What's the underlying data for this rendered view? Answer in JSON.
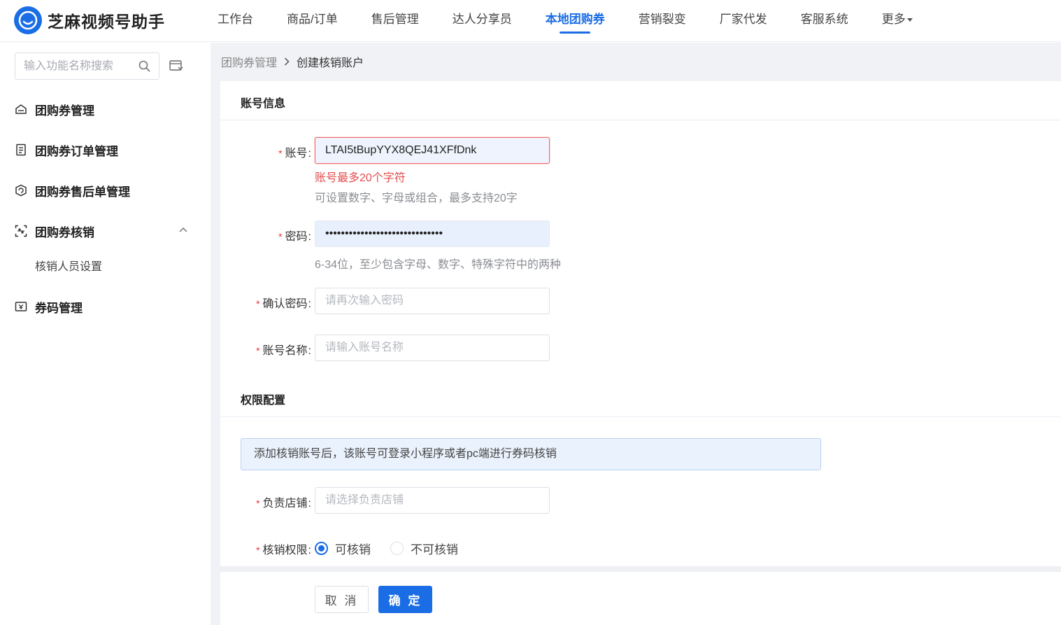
{
  "app": {
    "title": "芝麻视频号助手"
  },
  "nav": {
    "items": [
      {
        "label": "工作台"
      },
      {
        "label": "商品/订单"
      },
      {
        "label": "售后管理"
      },
      {
        "label": "达人分享员"
      },
      {
        "label": "本地团购券",
        "active": true
      },
      {
        "label": "营销裂变"
      },
      {
        "label": "厂家代发"
      },
      {
        "label": "客服系统"
      },
      {
        "label": "更多"
      }
    ]
  },
  "sidebar": {
    "search_placeholder": "输入功能名称搜索",
    "items": [
      {
        "label": "团购券管理",
        "icon": "coupon-icon"
      },
      {
        "label": "团购券订单管理",
        "icon": "order-list-icon"
      },
      {
        "label": "团购券售后单管理",
        "icon": "aftersale-icon"
      },
      {
        "label": "团购券核销",
        "icon": "scan-icon",
        "expanded": true,
        "children": [
          {
            "label": "核销人员设置"
          }
        ]
      },
      {
        "label": "券码管理",
        "icon": "ticket-icon"
      }
    ]
  },
  "breadcrumb": {
    "parent": "团购券管理",
    "current": "创建核销账户"
  },
  "form": {
    "account_section_title": "账号信息",
    "account": {
      "label": "账号",
      "value": "LTAI5tBupYYX8QEJ41XFfDnk",
      "error": "账号最多20个字符",
      "hint": "可设置数字、字母或组合，最多支持20字"
    },
    "password": {
      "label": "密码",
      "value": "••••••••••••••••••••••••••••••",
      "hint": "6-34位，至少包含字母、数字、特殊字符中的两种"
    },
    "confirm_password": {
      "label": "确认密码",
      "placeholder": "请再次输入密码"
    },
    "account_name": {
      "label": "账号名称",
      "placeholder": "请输入账号名称"
    },
    "permission_section_title": "权限配置",
    "notice": "添加核销账号后，该账号可登录小程序或者pc端进行券码核销",
    "store": {
      "label": "负责店铺",
      "placeholder": "请选择负责店铺"
    },
    "verify_permission": {
      "label": "核销权限",
      "options": [
        {
          "label": "可核销",
          "checked": true
        },
        {
          "label": "不可核销",
          "checked": false
        }
      ]
    }
  },
  "actions": {
    "cancel": "取 消",
    "confirm": "确 定"
  },
  "colors": {
    "primary": "#1b6de6",
    "error": "#e34d4d",
    "required": "#e33333"
  }
}
